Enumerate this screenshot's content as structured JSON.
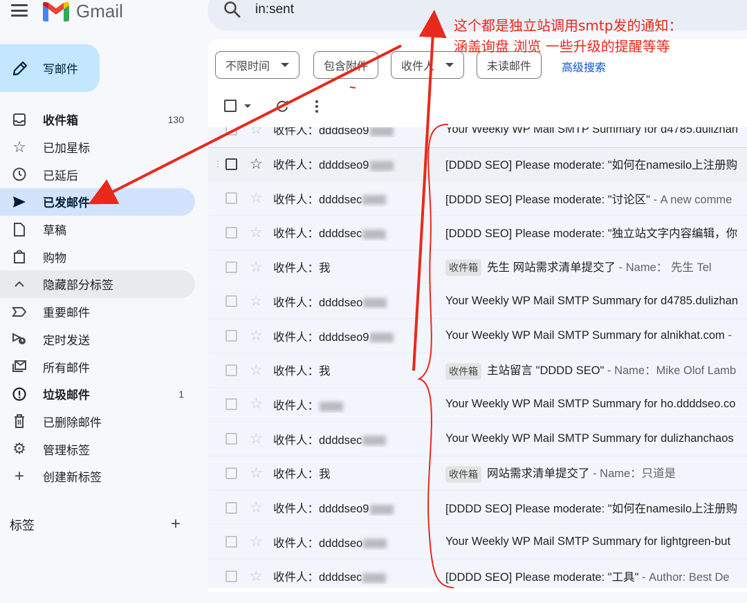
{
  "app": {
    "logo_text": "Gmail"
  },
  "search": {
    "query": "in:sent"
  },
  "compose": {
    "label": "写邮件"
  },
  "nav": [
    {
      "label": "收件箱",
      "count": "130",
      "icon": "inbox-icon",
      "style": "bold"
    },
    {
      "label": "已加星标",
      "count": "",
      "icon": "star-icon",
      "style": ""
    },
    {
      "label": "已延后",
      "count": "",
      "icon": "clock-icon",
      "style": ""
    },
    {
      "label": "已发邮件",
      "count": "",
      "icon": "send-icon",
      "style": "active"
    },
    {
      "label": "草稿",
      "count": "",
      "icon": "draft-icon",
      "style": ""
    },
    {
      "label": "购物",
      "count": "",
      "icon": "shopping-icon",
      "style": ""
    },
    {
      "label": "隐藏部分标签",
      "count": "",
      "icon": "chevron-up-icon",
      "style": "grey"
    },
    {
      "label": "重要邮件",
      "count": "",
      "icon": "important-icon",
      "style": ""
    },
    {
      "label": "定时发送",
      "count": "",
      "icon": "scheduled-send-icon",
      "style": ""
    },
    {
      "label": "所有邮件",
      "count": "",
      "icon": "all-mail-icon",
      "style": ""
    },
    {
      "label": "垃圾邮件",
      "count": "1",
      "icon": "spam-icon",
      "style": "bold"
    },
    {
      "label": "已删除邮件",
      "count": "",
      "icon": "trash-icon",
      "style": ""
    },
    {
      "label": "管理标签",
      "count": "",
      "icon": "gear-icon",
      "style": ""
    },
    {
      "label": "创建新标签",
      "count": "",
      "icon": "plus-icon",
      "style": ""
    }
  ],
  "labels_section": {
    "title": "标签",
    "add": "+"
  },
  "filters": {
    "time": "不限时间",
    "attachment": "包含附件",
    "recipient": "收件人",
    "unread": "未读邮件",
    "advanced": "高级搜索"
  },
  "emails": [
    {
      "to_prefix": "收件人：",
      "to": "ddddseo9",
      "blurred": true,
      "tag": "",
      "subject": "Your Weekly WP Mail SMTP Summary for d4785.dulizhan",
      "snippet": "",
      "highlight": false
    },
    {
      "to_prefix": "收件人：",
      "to": "ddddseo9",
      "blurred": true,
      "tag": "",
      "subject": "[DDDD SEO] Please moderate: \"如何在namesilo上注册购",
      "snippet": "",
      "highlight": true
    },
    {
      "to_prefix": "收件人：",
      "to": "ddddsec",
      "blurred": true,
      "tag": "",
      "subject": "[DDDD SEO] Please moderate: \"讨论区\"",
      "snippet": " - A new comme",
      "highlight": false
    },
    {
      "to_prefix": "收件人：",
      "to": "ddddsec",
      "blurred": true,
      "tag": "",
      "subject": "[DDDD SEO] Please moderate: \"独立站文字内容编辑，你",
      "snippet": "",
      "highlight": false
    },
    {
      "to_prefix": "收件人：",
      "to": "我",
      "blurred": false,
      "tag": "收件箱",
      "subject": "先生 网站需求清单提交了",
      "snippet": " - Name：   先生 Tel",
      "highlight": false
    },
    {
      "to_prefix": "收件人：",
      "to": "ddddseo",
      "blurred": true,
      "tag": "",
      "subject": "Your Weekly WP Mail SMTP Summary for d4785.dulizhan",
      "snippet": "",
      "highlight": false
    },
    {
      "to_prefix": "收件人：",
      "to": "ddddseo9",
      "blurred": true,
      "tag": "",
      "subject": "Your Weekly WP Mail SMTP Summary for alnikhat.com",
      "snippet": " -",
      "highlight": false
    },
    {
      "to_prefix": "收件人：",
      "to": "我",
      "blurred": false,
      "tag": "收件箱",
      "subject": "主站留言 \"DDDD SEO\"",
      "snippet": " - Name：Mike Olof Lamb",
      "highlight": false
    },
    {
      "to_prefix": "收件人：",
      "to": "",
      "blurred": true,
      "tag": "",
      "subject": "Your Weekly WP Mail SMTP Summary for ho.ddddseo.co",
      "snippet": "",
      "highlight": false
    },
    {
      "to_prefix": "收件人：",
      "to": "ddddsec",
      "blurred": true,
      "tag": "",
      "subject": "Your Weekly WP Mail SMTP Summary for dulizhanchaos",
      "snippet": "",
      "highlight": false
    },
    {
      "to_prefix": "收件人：",
      "to": "我",
      "blurred": false,
      "tag": "收件箱",
      "subject": "网站需求清单提交了",
      "snippet": " - Name：只道是",
      "highlight": false
    },
    {
      "to_prefix": "收件人：",
      "to": "ddddseo9",
      "blurred": true,
      "tag": "",
      "subject": "[DDDD SEO] Please moderate: \"如何在namesilo上注册购",
      "snippet": "",
      "highlight": false
    },
    {
      "to_prefix": "收件人：",
      "to": "ddddseo",
      "blurred": true,
      "tag": "",
      "subject": "Your Weekly WP Mail SMTP Summary for lightgreen-but",
      "snippet": "",
      "highlight": false
    },
    {
      "to_prefix": "收件人：",
      "to": "ddddsec",
      "blurred": true,
      "tag": "",
      "subject": "[DDDD SEO] Please moderate: \"工具\"",
      "snippet": " - Author: Best De",
      "highlight": false
    }
  ],
  "annotation": {
    "line1": "这个都是独立站调用smtp发的通知：",
    "line2": "涵盖询盘 浏览 一些升级的提醒等等",
    "color": "#e8291c"
  }
}
